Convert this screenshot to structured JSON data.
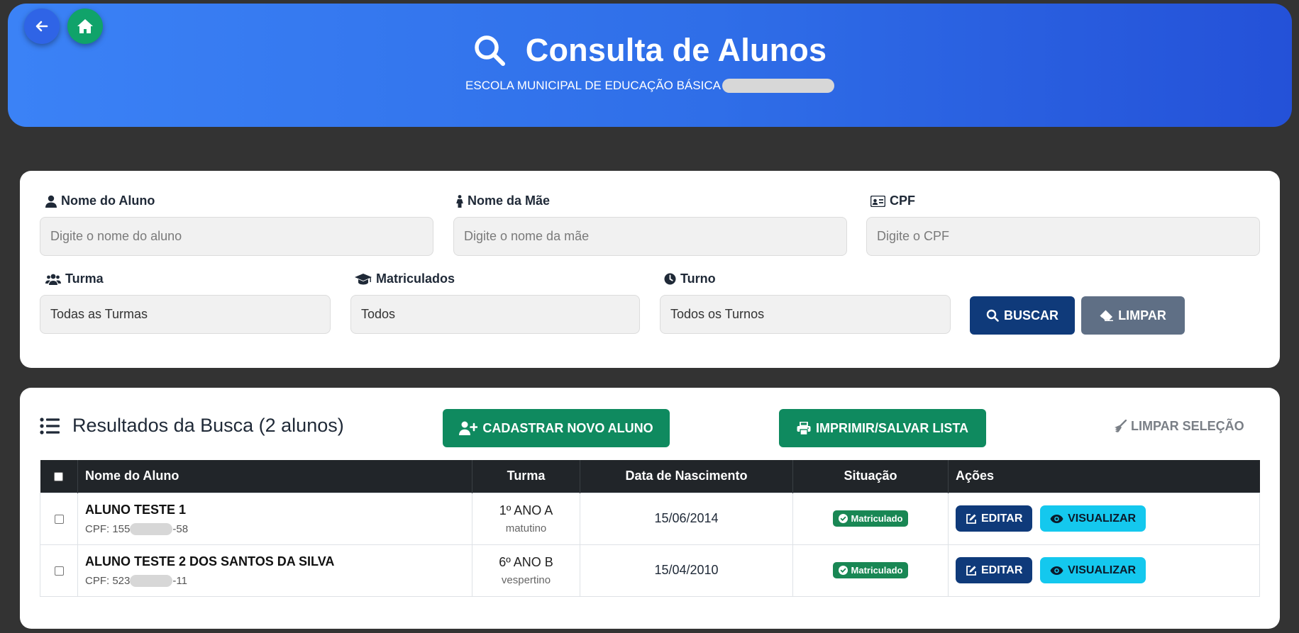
{
  "header": {
    "title": "Consulta de Alunos",
    "subtitle": "ESCOLA MUNICIPAL DE EDUCAÇÃO BÁSICA",
    "back_icon": "arrow-left-icon",
    "home_icon": "home-icon",
    "gradient_start": "#3b82f6",
    "gradient_end": "#2451d8"
  },
  "filters": {
    "nome_aluno": {
      "label": "Nome do Aluno",
      "placeholder": "Digite o nome do aluno"
    },
    "nome_mae": {
      "label": "Nome da Mãe",
      "placeholder": "Digite o nome da mãe"
    },
    "cpf": {
      "label": "CPF",
      "placeholder": "Digite o CPF"
    },
    "turma": {
      "label": "Turma",
      "value": "Todas as Turmas"
    },
    "matriculados": {
      "label": "Matriculados",
      "value": "Todos"
    },
    "turno": {
      "label": "Turno",
      "value": "Todos os Turnos"
    },
    "buscar_label": "BUSCAR",
    "limpar_label": "LIMPAR"
  },
  "results": {
    "title": "Resultados da Busca (2 alunos)",
    "cadastrar_label": "CADASTRAR NOVO ALUNO",
    "imprimir_label": "IMPRIMIR/SALVAR LISTA",
    "limpar_selecao_label": "LIMPAR SELEÇÃO",
    "columns": {
      "nome": "Nome do Aluno",
      "turma": "Turma",
      "nascimento": "Data de Nascimento",
      "situacao": "Situação",
      "acoes": "Ações"
    },
    "rows": [
      {
        "nome": "ALUNO TESTE 1",
        "cpf_prefix": "CPF: 155",
        "cpf_suffix": "-58",
        "turma": "1º ANO A",
        "turno": "matutino",
        "nascimento": "15/06/2014",
        "situacao": "Matriculado",
        "editar": "EDITAR",
        "visualizar": "VISUALIZAR"
      },
      {
        "nome": "ALUNO TESTE 2 DOS SANTOS DA SILVA",
        "cpf_prefix": "CPF: 523",
        "cpf_suffix": "-11",
        "turma": "6º ANO B",
        "turno": "vespertino",
        "nascimento": "15/04/2010",
        "situacao": "Matriculado",
        "editar": "EDITAR",
        "visualizar": "VISUALIZAR"
      }
    ]
  },
  "colors": {
    "primary_dark": "#0f3a7a",
    "success": "#0f8a5f",
    "badge": "#198754",
    "info": "#14c8ee",
    "secondary": "#5f6f85"
  }
}
